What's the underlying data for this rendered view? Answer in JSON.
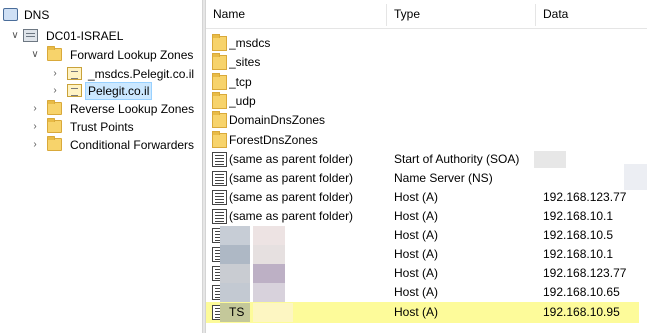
{
  "tree": {
    "root": {
      "label": "DNS",
      "icon": "dns-icon"
    },
    "server": {
      "label": "DC01-ISRAEL",
      "icon": "server-icon"
    },
    "forward_zones": {
      "label": "Forward Lookup Zones",
      "icon": "folder-icon"
    },
    "zone_msdcs": {
      "label": "_msdcs.Pelegit.co.il",
      "icon": "zone-icon"
    },
    "zone_pelegit": {
      "label": "Pelegit.co.il",
      "icon": "zone-icon",
      "selected": true
    },
    "reverse_zones": {
      "label": "Reverse Lookup Zones",
      "icon": "folder-icon"
    },
    "trust_points": {
      "label": "Trust Points",
      "icon": "folder-icon"
    },
    "conditional_forwarders": {
      "label": "Conditional Forwarders",
      "icon": "folder-icon"
    }
  },
  "columns": {
    "name": "Name",
    "type": "Type",
    "data": "Data"
  },
  "rows": [
    {
      "name": "_msdcs",
      "type": "",
      "data": "",
      "icon": "folder-record-icon"
    },
    {
      "name": "_sites",
      "type": "",
      "data": "",
      "icon": "folder-icon"
    },
    {
      "name": "_tcp",
      "type": "",
      "data": "",
      "icon": "folder-icon"
    },
    {
      "name": "_udp",
      "type": "",
      "data": "",
      "icon": "folder-icon"
    },
    {
      "name": "DomainDnsZones",
      "type": "",
      "data": "",
      "icon": "folder-icon"
    },
    {
      "name": "ForestDnsZones",
      "type": "",
      "data": "",
      "icon": "folder-icon"
    },
    {
      "name": "(same as parent folder)",
      "type": "Start of Authority (SOA)",
      "data": "",
      "icon": "record-icon"
    },
    {
      "name": "(same as parent folder)",
      "type": "Name Server (NS)",
      "data": "",
      "icon": "record-icon"
    },
    {
      "name": "(same as parent folder)",
      "type": "Host (A)",
      "data": "192.168.123.77",
      "icon": "record-icon"
    },
    {
      "name": "(same as parent folder)",
      "type": "Host (A)",
      "data": "192.168.10.1",
      "icon": "record-icon"
    },
    {
      "name": "",
      "type": "Host (A)",
      "data": "192.168.10.5",
      "icon": "record-icon"
    },
    {
      "name": "",
      "type": "Host (A)",
      "data": "192.168.10.1",
      "icon": "record-icon"
    },
    {
      "name": "",
      "type": "Host (A)",
      "data": "192.168.123.77",
      "icon": "record-icon"
    },
    {
      "name": "",
      "type": "Host (A)",
      "data": "192.168.10.65",
      "icon": "record-icon"
    },
    {
      "name": "TS",
      "type": "Host (A)",
      "data": "192.168.10.95",
      "icon": "record-icon",
      "highlighted": true
    }
  ],
  "colors": {
    "selection": "#cce8ff",
    "highlight": "#fdfb9a",
    "folder": "#f7d36b"
  }
}
